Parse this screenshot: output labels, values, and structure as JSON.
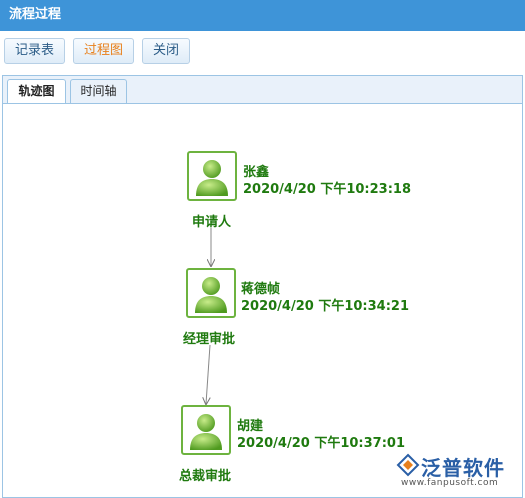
{
  "window": {
    "title": "流程过程"
  },
  "toolbar": {
    "record_label": "记录表",
    "process_label": "过程图",
    "close_label": "关闭"
  },
  "tabs": [
    {
      "label": "轨迹图",
      "active": true
    },
    {
      "label": "时间轴",
      "active": false
    }
  ],
  "flow": {
    "nodes": [
      {
        "name": "张鑫",
        "time": "2020/4/20 下午10:23:18",
        "role": "申请人",
        "icon": "user-icon"
      },
      {
        "name": "蒋德帧",
        "time": "2020/4/20 下午10:34:21",
        "role": "经理审批",
        "icon": "user-icon"
      },
      {
        "name": "胡建",
        "time": "2020/4/20 下午10:37:01",
        "role": "总裁审批",
        "icon": "user-icon"
      }
    ]
  },
  "watermark": {
    "brand": "泛普软件",
    "url": "www.fanpusoft.com"
  },
  "colors": {
    "titlebar": "#3e94d8",
    "node_text": "#1f7a0f",
    "node_border": "#6db33f",
    "active_button_text": "#e8801c"
  }
}
